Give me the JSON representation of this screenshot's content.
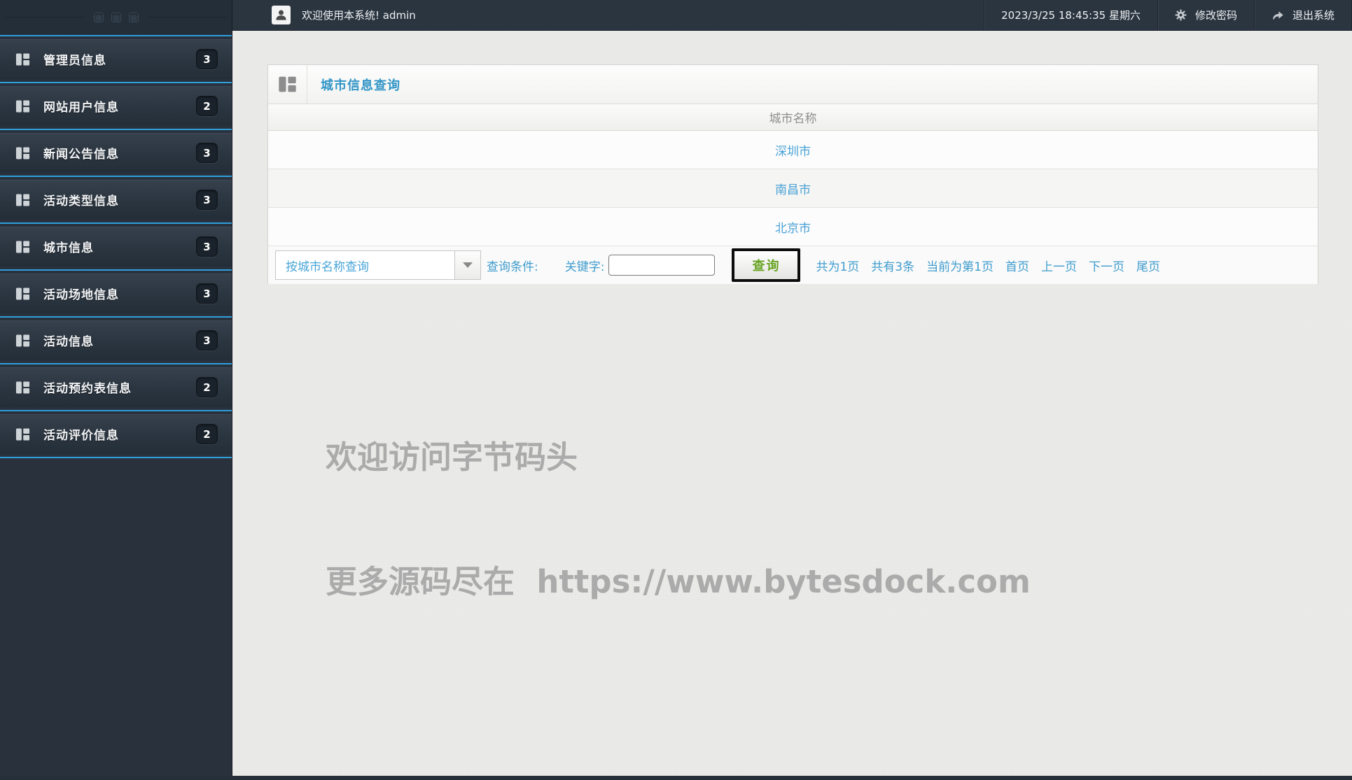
{
  "topbar": {
    "welcome": "欢迎使用本系统! admin",
    "datetime": "2023/3/25 18:45:35 星期六",
    "change_password_label": "修改密码",
    "logout_label": "退出系统"
  },
  "sidebar": {
    "items": [
      {
        "label": "管理员信息",
        "count": "3"
      },
      {
        "label": "网站用户信息",
        "count": "2"
      },
      {
        "label": "新闻公告信息",
        "count": "3"
      },
      {
        "label": "活动类型信息",
        "count": "3"
      },
      {
        "label": "城市信息",
        "count": "3"
      },
      {
        "label": "活动场地信息",
        "count": "3"
      },
      {
        "label": "活动信息",
        "count": "3"
      },
      {
        "label": "活动预约表信息",
        "count": "2"
      },
      {
        "label": "活动评价信息",
        "count": "2"
      }
    ]
  },
  "panel": {
    "title": "城市信息查询",
    "table": {
      "header": "城市名称",
      "rows": [
        "深圳市",
        "南昌市",
        "北京市"
      ]
    },
    "query": {
      "select_value": "按城市名称查询",
      "condition_label": "查询条件:",
      "keyword_label": "关键字:",
      "input_value": "",
      "search_button_label": "查询",
      "pagination_status": [
        "共为1页",
        "共有3条",
        "当前为第1页"
      ],
      "pagination_links": [
        "首页",
        "上一页",
        "下一页",
        "尾页"
      ]
    }
  },
  "watermark": {
    "line1": "欢迎访问字节码头",
    "line2": "更多源码尽在  https://www.bytesdock.com"
  },
  "colors": {
    "accent_blue": "#2f9fdd",
    "link_blue": "#4aa2d6",
    "title_blue": "#3295c7",
    "button_green": "#67a322",
    "sidebar_dark": "#29323c",
    "topbar_dark": "#2b3540"
  }
}
